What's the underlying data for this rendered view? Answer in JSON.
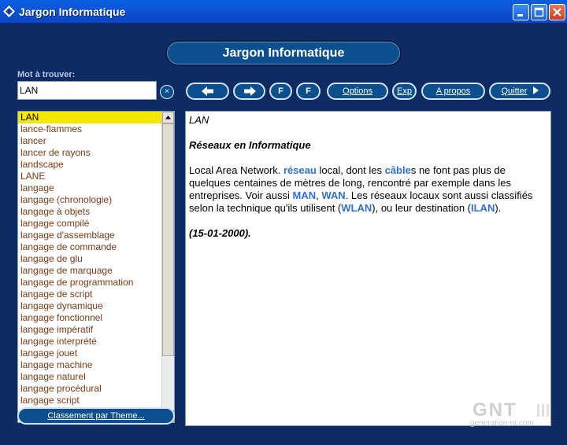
{
  "window": {
    "title": "Jargon Informatique"
  },
  "header": {
    "title": "Jargon Informatique"
  },
  "search": {
    "label": "Mot à trouver:",
    "value": "LAN",
    "clear_label": "×"
  },
  "toolbar": {
    "f1_label": "F",
    "f2_label": "F",
    "options_label": "Options",
    "exp_label": "Exp",
    "apropos_label": "A propos",
    "quitter_label": "Quitter"
  },
  "wordlist": {
    "items": [
      "LAN",
      "lance-flammes",
      "lancer",
      "lancer de rayons",
      "landscape",
      "LANE",
      "langage",
      "langage (chronologie)",
      "langage à objets",
      "langage compilé",
      "langage d'assemblage",
      "langage de commande",
      "langage de glu",
      "langage de marquage",
      "langage de programmation",
      "langage de script",
      "langage dynamique",
      "langage fonctionnel",
      "langage impératif",
      "langage interprété",
      "langage jouet",
      "langage machine",
      "langage naturel",
      "langage procédural",
      "langage script"
    ]
  },
  "classement": {
    "label": "Classement par Theme..."
  },
  "definition": {
    "term": "LAN",
    "category": "Réseaux en Informatique",
    "body_1": "Local Area Network. ",
    "link_reseau": "réseau",
    "body_2": " local, dont les ",
    "link_cable": "câble",
    "body_3": "s ne font pas plus de quelques centaines de mètres de long, rencontré par exemple dans les entreprises. Voir aussi ",
    "link_man": "MAN",
    "sep_1": ", ",
    "link_wan": "WAN",
    "body_4": ". Les réseaux locaux sont aussi classifiés selon la technique qu'ils utilisent (",
    "link_wlan": "WLAN",
    "body_5": "), ou leur destination (",
    "link_ilan": "ILAN",
    "body_6": ").",
    "date": "(15-01-2000)."
  },
  "watermark": {
    "logo": "GNT",
    "site": "generation-nt.com"
  },
  "colors": {
    "titlebar": "#0a5fe0",
    "background": "#0f2b63",
    "button": "#0b4f8f",
    "selection": "#f5e800",
    "link": "#2f6fd6"
  }
}
